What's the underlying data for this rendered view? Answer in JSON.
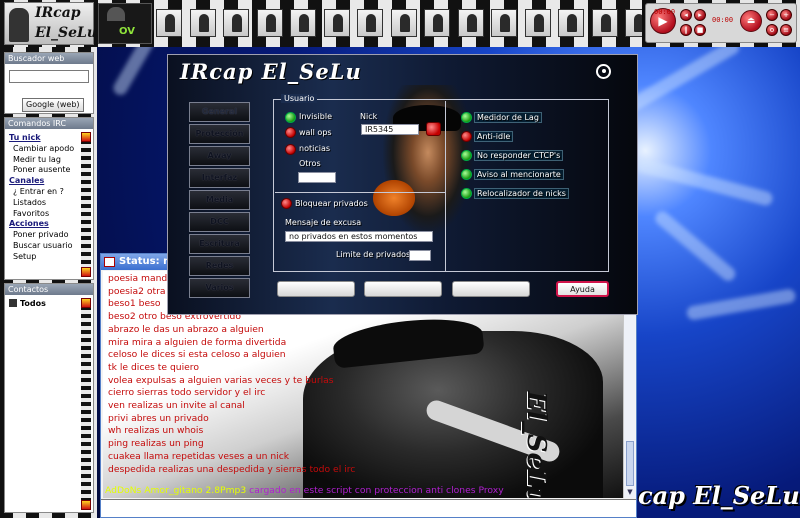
{
  "app": {
    "brand_line1": "IRcap",
    "brand_line2": "El_SeLu",
    "ov_label": "OV",
    "thumbnail_count": 16
  },
  "player": {
    "time_left": "00:00",
    "time_right": "00:00",
    "small_label": "0 5 5"
  },
  "sidebar": {
    "web_search": {
      "title": "Buscador web",
      "input_value": "",
      "google_button": "Google (web)"
    },
    "irc_commands": {
      "title": "Comandos IRC",
      "items": [
        {
          "label": "Tu nick",
          "type": "heading"
        },
        {
          "label": "Cambiar apodo",
          "type": "sub"
        },
        {
          "label": "Medir tu lag",
          "type": "sub"
        },
        {
          "label": "Poner ausente",
          "type": "sub"
        },
        {
          "label": "Canales",
          "type": "heading"
        },
        {
          "label": "¿ Entrar en ?",
          "type": "sub"
        },
        {
          "label": "Listados",
          "type": "sub"
        },
        {
          "label": "Favoritos",
          "type": "sub"
        },
        {
          "label": "Acciones",
          "type": "heading"
        },
        {
          "label": "Poner privado",
          "type": "sub"
        },
        {
          "label": "Buscar usuario",
          "type": "sub"
        },
        {
          "label": "Setup",
          "type": "sub"
        }
      ]
    },
    "contacts": {
      "title": "Contactos",
      "group": "Todos"
    }
  },
  "desktop": {
    "logo_text": "cap El_SeLu"
  },
  "status_window": {
    "title": "Status: no",
    "messages": [
      "poesia manda",
      "poesia2 otra",
      "beso1 beso",
      "beso2 otro beso extrovertido",
      "abrazo le das un abrazo a alguien",
      "mira mira a alguien de forma divertida",
      "celoso le dices si esta celoso a alguien",
      "tk le dices te quiero",
      "volea expulsas a alguien varias veces y te burlas",
      "cierro sierras todo servidor y el irc",
      "ven realizas un invite al canal",
      "privi abres un privado",
      "wh realizas un whois",
      "ping realizas un ping",
      "cuakea llama repetidas veses a un nick",
      "despedida realizas una despedida y sierras todo el irc"
    ],
    "addon_prefix": "AdDoNs Amor_gitano 2.8Pmp3",
    "addon_suffix": "cargado en este script con proteccion anti clones Proxy",
    "photo_logo": "El_SeLu",
    "input_value": ""
  },
  "dialog": {
    "title": "IRcap El_SeLu",
    "tabs": [
      "General",
      "Protección",
      "Away",
      "Interfaz",
      "Media",
      "DCC",
      "Escritura",
      "Redes",
      "Varios"
    ],
    "active_tab": "General",
    "group_label": "Usuario",
    "left_options": [
      {
        "label": "Invisible",
        "checked": true
      },
      {
        "label": "wall ops",
        "checked": false
      },
      {
        "label": "noticias",
        "checked": false
      }
    ],
    "otros_label": "Otros",
    "otros_value": "",
    "nick_label": "Nick",
    "nick_value": "IR5345",
    "block_private": {
      "label": "Bloquear privados",
      "checked": false
    },
    "excuse_label": "Mensaje de excusa",
    "excuse_value": "no privados en estos momentos",
    "limit_label": "Limite de privados",
    "limit_value": "",
    "right_options": [
      {
        "label": "Medidor de Lag",
        "checked": true
      },
      {
        "label": "Anti-idle",
        "checked": false
      },
      {
        "label": "No responder CTCP's",
        "checked": true
      },
      {
        "label": "Aviso al mencionarte",
        "checked": true
      },
      {
        "label": "Relocalizador de nicks",
        "checked": true
      }
    ],
    "buttons": [
      "",
      "",
      "",
      "Ayuda"
    ]
  }
}
